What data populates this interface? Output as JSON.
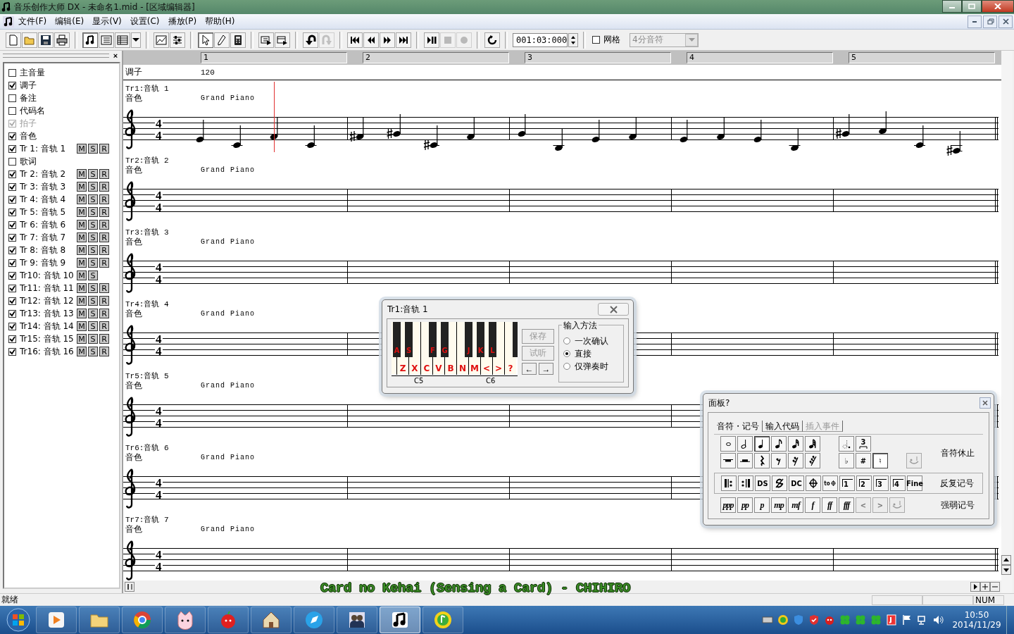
{
  "window": {
    "title": "音乐创作大师 DX - 未命名1.mid - [区域编辑器]"
  },
  "menu": [
    "文件(F)",
    "编辑(E)",
    "显示(V)",
    "设置(C)",
    "播放(P)",
    "帮助(H)"
  ],
  "toolbar": {
    "buttons": [
      {
        "pressed": false,
        "disabled": false
      },
      {
        "pressed": false,
        "disabled": false
      },
      {
        "pressed": false,
        "disabled": false
      },
      {
        "pressed": false,
        "disabled": false
      },
      {
        "pressed": true,
        "disabled": false
      },
      {
        "pressed": false,
        "disabled": false
      },
      {
        "pressed": false,
        "disabled": false
      },
      {
        "pressed": false,
        "disabled": false
      },
      {
        "pressed": false,
        "disabled": false
      },
      {
        "pressed": false,
        "disabled": false
      },
      {
        "pressed": true,
        "disabled": false
      },
      {
        "pressed": false,
        "disabled": false
      },
      {
        "pressed": false,
        "disabled": false
      },
      {
        "pressed": false,
        "disabled": false
      },
      {
        "pressed": false,
        "disabled": false
      },
      {
        "pressed": false,
        "disabled": false
      },
      {
        "pressed": false,
        "disabled": true
      },
      {
        "pressed": false,
        "disabled": false
      },
      {
        "pressed": false,
        "disabled": false
      },
      {
        "pressed": false,
        "disabled": false
      },
      {
        "pressed": false,
        "disabled": false
      },
      {
        "pressed": false,
        "disabled": false
      },
      {
        "pressed": false,
        "disabled": true
      },
      {
        "pressed": false,
        "disabled": true
      },
      {
        "pressed": false,
        "disabled": false
      }
    ],
    "time": "001:03:000",
    "grid": {
      "label": "网格",
      "checked": false
    },
    "note_value": {
      "value": "4分音符",
      "disabled": true
    }
  },
  "sidebar": {
    "close": "×",
    "items": [
      {
        "kind": "option",
        "label": "主音量",
        "checked": false,
        "disabled": false
      },
      {
        "kind": "option",
        "label": "调子",
        "checked": true,
        "disabled": false
      },
      {
        "kind": "option",
        "label": "备注",
        "checked": false,
        "disabled": false
      },
      {
        "kind": "option",
        "label": "代码名",
        "checked": false,
        "disabled": false
      },
      {
        "kind": "option",
        "label": "拍子",
        "checked": true,
        "disabled": true
      },
      {
        "kind": "option",
        "label": "音色",
        "checked": true,
        "disabled": false
      },
      {
        "kind": "track",
        "label": "Tr 1: 音轨 1",
        "checked": true,
        "disabled": false,
        "buttons": [
          "M",
          "S",
          "R"
        ]
      },
      {
        "kind": "option",
        "label": "歌词",
        "checked": false,
        "disabled": false
      },
      {
        "kind": "track",
        "label": "Tr 2: 音轨 2",
        "checked": true,
        "disabled": false,
        "buttons": [
          "M",
          "S",
          "R"
        ]
      },
      {
        "kind": "track",
        "label": "Tr 3: 音轨 3",
        "checked": true,
        "disabled": false,
        "buttons": [
          "M",
          "S",
          "R"
        ]
      },
      {
        "kind": "track",
        "label": "Tr 4: 音轨 4",
        "checked": true,
        "disabled": false,
        "buttons": [
          "M",
          "S",
          "R"
        ]
      },
      {
        "kind": "track",
        "label": "Tr 5: 音轨 5",
        "checked": true,
        "disabled": false,
        "buttons": [
          "M",
          "S",
          "R"
        ]
      },
      {
        "kind": "track",
        "label": "Tr 6: 音轨 6",
        "checked": true,
        "disabled": false,
        "buttons": [
          "M",
          "S",
          "R"
        ]
      },
      {
        "kind": "track",
        "label": "Tr 7: 音轨 7",
        "checked": true,
        "disabled": false,
        "buttons": [
          "M",
          "S",
          "R"
        ]
      },
      {
        "kind": "track",
        "label": "Tr 8: 音轨 8",
        "checked": true,
        "disabled": false,
        "buttons": [
          "M",
          "S",
          "R"
        ]
      },
      {
        "kind": "track",
        "label": "Tr 9: 音轨 9",
        "checked": true,
        "disabled": false,
        "buttons": [
          "M",
          "S",
          "R"
        ]
      },
      {
        "kind": "track",
        "label": "Tr10: 音轨 10",
        "checked": true,
        "disabled": false,
        "buttons": [
          "M",
          "S"
        ]
      },
      {
        "kind": "track",
        "label": "Tr11: 音轨 11",
        "checked": true,
        "disabled": false,
        "buttons": [
          "M",
          "S",
          "R"
        ]
      },
      {
        "kind": "track",
        "label": "Tr12: 音轨 12",
        "checked": true,
        "disabled": false,
        "buttons": [
          "M",
          "S",
          "R"
        ]
      },
      {
        "kind": "track",
        "label": "Tr13: 音轨 13",
        "checked": true,
        "disabled": false,
        "buttons": [
          "M",
          "S",
          "R"
        ]
      },
      {
        "kind": "track",
        "label": "Tr14: 音轨 14",
        "checked": true,
        "disabled": false,
        "buttons": [
          "M",
          "S",
          "R"
        ]
      },
      {
        "kind": "track",
        "label": "Tr15: 音轨 15",
        "checked": true,
        "disabled": false,
        "buttons": [
          "M",
          "S",
          "R"
        ]
      },
      {
        "kind": "track",
        "label": "Tr16: 音轨 16",
        "checked": true,
        "disabled": false,
        "buttons": [
          "M",
          "S",
          "R"
        ]
      }
    ]
  },
  "ruler": [
    "1",
    "2",
    "3",
    "4",
    "5"
  ],
  "tempo": {
    "label": "调子",
    "value": "120"
  },
  "tracks": [
    {
      "name": "Tr1:音轨 1",
      "patch_label": "音色",
      "patch": "Grand Piano",
      "time_signature": [
        "4",
        "4"
      ]
    },
    {
      "name": "Tr2:音轨 2",
      "patch_label": "音色",
      "patch": "Grand Piano",
      "time_signature": [
        "4",
        "4"
      ]
    },
    {
      "name": "Tr3:音轨 3",
      "patch_label": "音色",
      "patch": "Grand Piano",
      "time_signature": [
        "4",
        "4"
      ]
    },
    {
      "name": "Tr4:音轨 4",
      "patch_label": "音色",
      "patch": "Grand Piano",
      "time_signature": [
        "4",
        "4"
      ]
    },
    {
      "name": "Tr5:音轨 5",
      "patch_label": "音色",
      "patch": "Grand Piano",
      "time_signature": [
        "4",
        "4"
      ]
    },
    {
      "name": "Tr6:音轨 6",
      "patch_label": "音色",
      "patch": "Grand Piano",
      "time_signature": [
        "4",
        "4"
      ]
    },
    {
      "name": "Tr7:音轨 7",
      "patch_label": "音色",
      "patch": "Grand Piano",
      "time_signature": [
        "4",
        "4"
      ]
    }
  ],
  "keyboard_window": {
    "title": "Tr1:音轨 1",
    "white_keys": [
      "Z",
      "X",
      "C",
      "V",
      "B",
      "N",
      "M",
      "<",
      ">",
      "?"
    ],
    "black_keys": [
      "A",
      "S",
      "F",
      "G",
      "J",
      "K",
      "L"
    ],
    "octave_labels": [
      "C5",
      "C6"
    ],
    "buttons": [
      {
        "label": "保存",
        "disabled": true
      },
      {
        "label": "试听",
        "disabled": true
      }
    ],
    "arrows": [
      "←",
      "→"
    ],
    "input_method": {
      "title": "输入方法",
      "options": [
        {
          "label": "一次确认",
          "selected": false
        },
        {
          "label": "直接",
          "selected": true
        },
        {
          "label": "仅弹奏时",
          "selected": false
        }
      ]
    }
  },
  "palette": {
    "title": "面板?",
    "tabs": [
      {
        "label": "音符・记号",
        "selected": true,
        "disabled": false
      },
      {
        "label": "输入代码",
        "selected": false,
        "disabled": false
      },
      {
        "label": "插入事件",
        "selected": false,
        "disabled": true
      }
    ],
    "notes_group": {
      "label": "音符休止",
      "rows": [
        {
          "main": [
            {
              "kind": "whole",
              "pressed": false,
              "disabled": false
            },
            {
              "kind": "half",
              "pressed": false,
              "disabled": false
            },
            {
              "kind": "quarter",
              "pressed": true,
              "disabled": false
            },
            {
              "kind": "eighth",
              "pressed": false,
              "disabled": false
            },
            {
              "kind": "sixteenth",
              "pressed": false,
              "disabled": false
            },
            {
              "kind": "thirtysecond",
              "pressed": false,
              "disabled": false
            }
          ],
          "side": [
            {
              "kind": "dotted",
              "pressed": false,
              "disabled": false
            },
            {
              "kind": "triplet",
              "text": "3",
              "pressed": false,
              "disabled": false
            }
          ]
        },
        {
          "main": [
            {
              "kind": "wholerest",
              "pressed": false,
              "disabled": false
            },
            {
              "kind": "halfrest",
              "pressed": false,
              "disabled": false
            },
            {
              "kind": "quarterrest",
              "pressed": false,
              "disabled": false
            },
            {
              "kind": "eighthrest",
              "pressed": false,
              "disabled": false
            },
            {
              "kind": "sixteenthrest",
              "pressed": false,
              "disabled": false
            },
            {
              "kind": "thirtysecondrest",
              "pressed": false,
              "disabled": false
            }
          ],
          "side": [
            {
              "kind": "text",
              "text": "♭",
              "pressed": false,
              "disabled": false
            },
            {
              "kind": "text",
              "text": "#",
              "pressed": false,
              "disabled": false
            },
            {
              "kind": "text",
              "text": "♮",
              "pressed": true,
              "disabled": false
            }
          ],
          "extra": [
            {
              "kind": "tie",
              "pressed": false,
              "disabled": true
            }
          ]
        }
      ]
    },
    "repeat_group": {
      "label": "反复记号",
      "buttons": [
        {
          "kind": "repeatstart",
          "pressed": false,
          "disabled": false
        },
        {
          "kind": "repeatend",
          "pressed": false,
          "disabled": false
        },
        {
          "kind": "text",
          "text": "DS",
          "pressed": false,
          "disabled": false
        },
        {
          "kind": "segno",
          "pressed": false,
          "disabled": false
        },
        {
          "kind": "text",
          "text": "DC",
          "pressed": false,
          "disabled": false
        },
        {
          "kind": "coda",
          "pressed": false,
          "disabled": false
        },
        {
          "kind": "tocoda",
          "text": "to",
          "pressed": false,
          "disabled": false
        },
        {
          "kind": "volta",
          "text": "1",
          "pressed": false,
          "disabled": false
        },
        {
          "kind": "volta",
          "text": "2",
          "pressed": false,
          "disabled": false
        },
        {
          "kind": "volta",
          "text": "3",
          "pressed": false,
          "disabled": false
        },
        {
          "kind": "volta",
          "text": "4",
          "pressed": false,
          "disabled": false
        },
        {
          "kind": "text",
          "text": "Fine",
          "pressed": false,
          "disabled": false
        }
      ]
    },
    "dynamics_group": {
      "label": "强弱记号",
      "buttons": [
        {
          "kind": "dynamic",
          "text": "ppp",
          "pressed": false,
          "disabled": false
        },
        {
          "kind": "dynamic",
          "text": "pp",
          "pressed": false,
          "disabled": false
        },
        {
          "kind": "dynamic",
          "text": "p",
          "pressed": false,
          "disabled": false
        },
        {
          "kind": "dynamic",
          "text": "mp",
          "pressed": false,
          "disabled": false
        },
        {
          "kind": "dynamic",
          "text": "mf",
          "pressed": false,
          "disabled": false
        },
        {
          "kind": "dynamic",
          "text": "f",
          "pressed": false,
          "disabled": false
        },
        {
          "kind": "dynamic",
          "text": "ff",
          "pressed": false,
          "disabled": false
        },
        {
          "kind": "dynamic",
          "text": "fff",
          "pressed": false,
          "disabled": false
        },
        {
          "kind": "text",
          "text": "<",
          "pressed": false,
          "disabled": true
        },
        {
          "kind": "text",
          "text": ">",
          "pressed": false,
          "disabled": true
        },
        {
          "kind": "tie",
          "pressed": false,
          "disabled": true
        }
      ]
    }
  },
  "lyrics_overlay": "Card no Kehai (Sensing a Card) - CHIHIRO",
  "status_bar": {
    "message": "就绪",
    "indicator": "NUM"
  },
  "taskbar": {
    "apps": [
      {
        "kind": "player",
        "active": false
      },
      {
        "kind": "folder",
        "active": false
      },
      {
        "kind": "browser",
        "active": false
      },
      {
        "kind": "cat",
        "active": false
      },
      {
        "kind": "apple",
        "active": false
      },
      {
        "kind": "house",
        "active": false
      },
      {
        "kind": "compass",
        "active": false
      },
      {
        "kind": "people",
        "active": false
      },
      {
        "kind": "music",
        "active": true
      },
      {
        "kind": "disc",
        "active": false
      }
    ],
    "tray": [
      {
        "kind": "keyboard"
      },
      {
        "kind": "ball"
      },
      {
        "kind": "shield"
      },
      {
        "kind": "badge"
      },
      {
        "kind": "bug"
      },
      {
        "kind": "clover"
      },
      {
        "kind": "clover"
      },
      {
        "kind": "clover"
      },
      {
        "kind": "app"
      },
      {
        "kind": "flag"
      },
      {
        "kind": "network"
      },
      {
        "kind": "volume"
      }
    ],
    "time": "10:50",
    "date": "2014/11/29"
  }
}
